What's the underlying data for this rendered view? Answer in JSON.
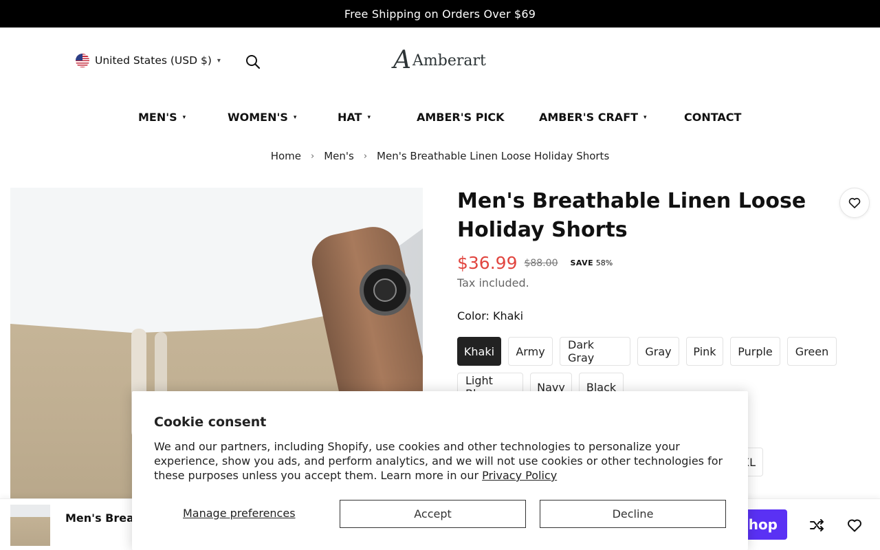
{
  "announcement": "Free Shipping on Orders Over $69",
  "header": {
    "locale_label": "United States (USD $)",
    "logo_mark": "A",
    "logo_text": "Amberart"
  },
  "nav": {
    "items": [
      {
        "label": "MEN'S",
        "has_dropdown": true
      },
      {
        "label": "WOMEN'S",
        "has_dropdown": true
      },
      {
        "label": "HAT",
        "has_dropdown": true
      },
      {
        "label": "AMBER'S PICK",
        "has_dropdown": false
      },
      {
        "label": "AMBER'S CRAFT",
        "has_dropdown": true
      },
      {
        "label": "CONTACT",
        "has_dropdown": false
      }
    ],
    "caret": "▾"
  },
  "breadcrumb": {
    "items": [
      "Home",
      "Men's",
      "Men's Breathable Linen Loose Holiday Shorts"
    ],
    "separator": "›"
  },
  "product": {
    "title": "Men's Breathable Linen Loose Holiday Shorts",
    "price": "$36.99",
    "compare_price": "$88.00",
    "save_label": "SAVE",
    "save_value": "58%",
    "tax_note": "Tax included.",
    "color_label": "Color: Khaki",
    "colors": [
      "Khaki",
      "Army",
      "Dark Gray",
      "Gray",
      "Pink",
      "Purple",
      "Green",
      "Light Blue",
      "Navy",
      "Black"
    ],
    "selected_color": "Khaki",
    "partial_size_text": "XL"
  },
  "sticky_bar": {
    "title": "Men's Breat",
    "shop_button": "hop"
  },
  "cookie": {
    "title": "Cookie consent",
    "text": "We and our partners, including Shopify, use cookies and other technologies to personalize your experience, show you ads, and perform analytics, and we will not use cookies or other technologies for these purposes unless you accept them. Learn more in our ",
    "link": "Privacy Policy",
    "manage": "Manage preferences",
    "accept": "Accept",
    "decline": "Decline"
  },
  "colors": {
    "accent_price": "#e1453f",
    "shop_pay": "#5a31f4",
    "announce_bg": "#000000"
  }
}
